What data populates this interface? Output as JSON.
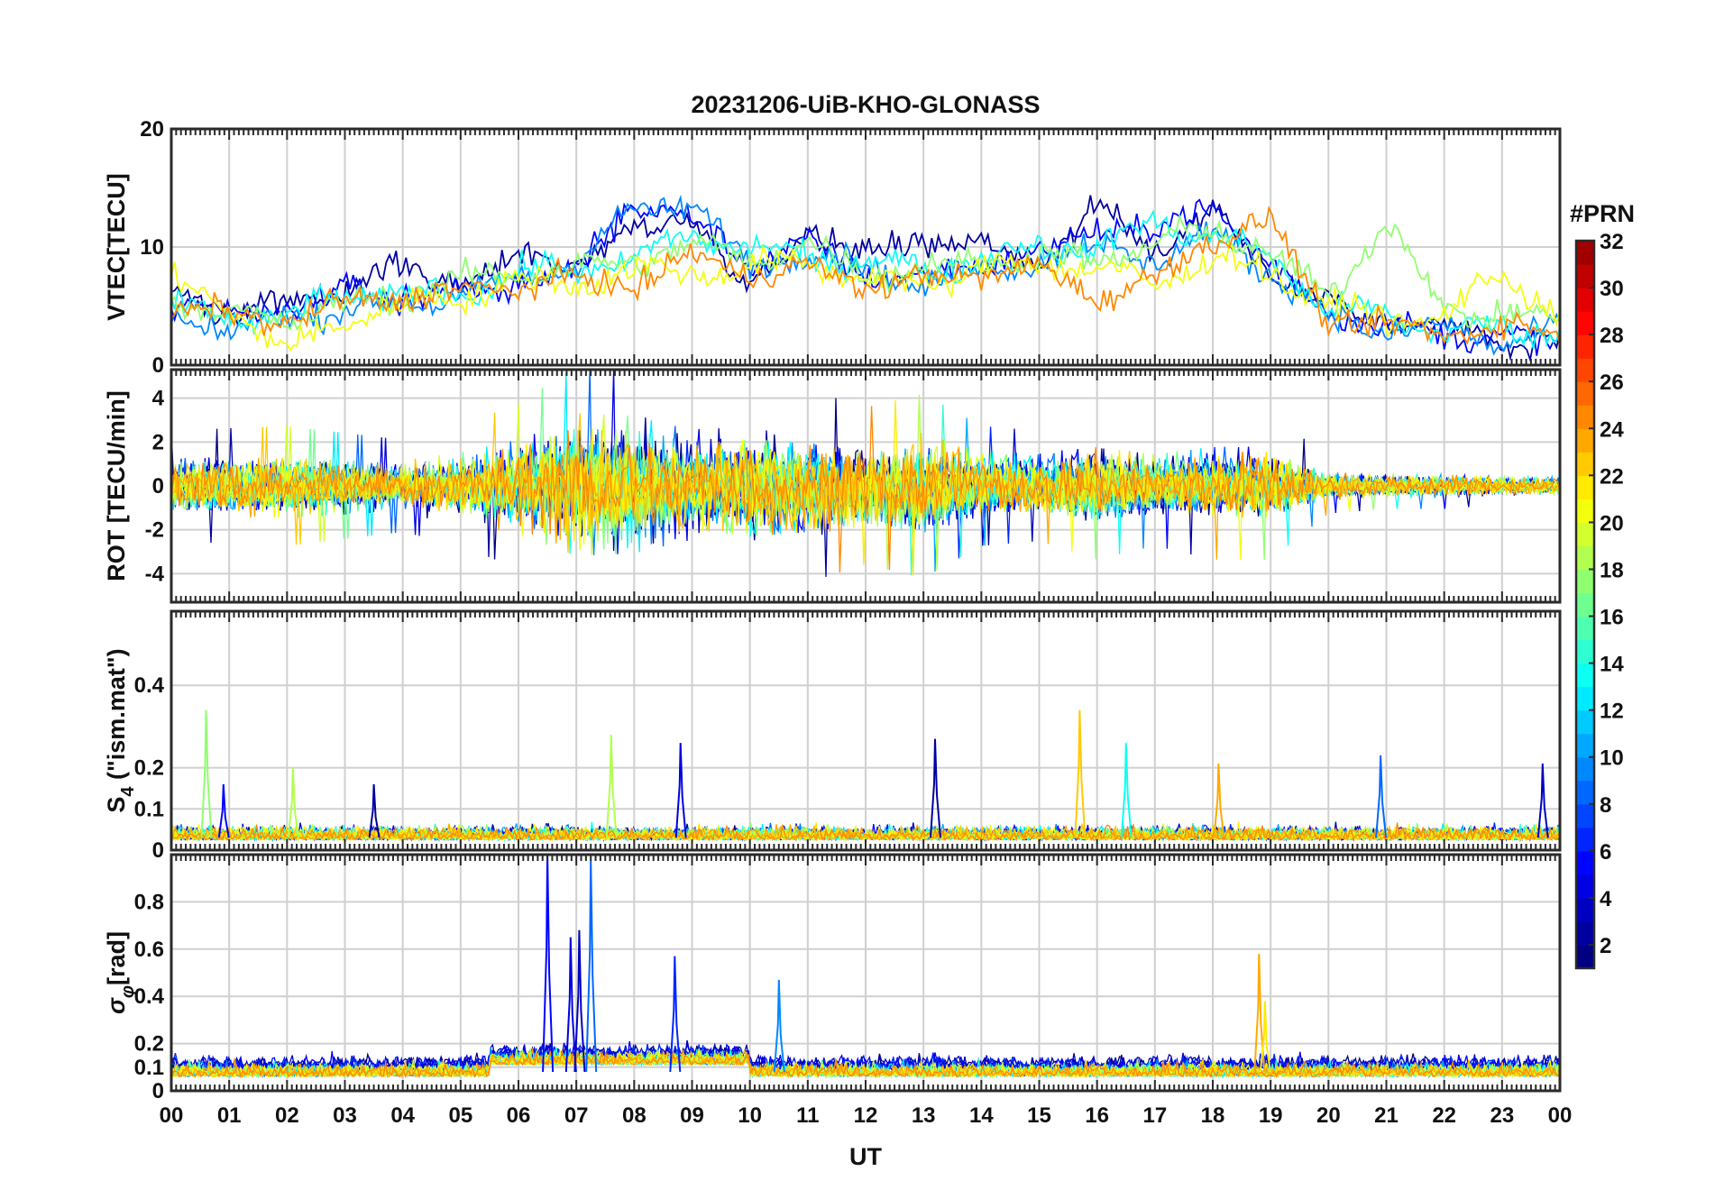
{
  "chart_data": {
    "title": "20231206-UiB-KHO-GLONASS",
    "type": "line",
    "xlabel": "UT",
    "x_ticks": [
      "00",
      "01",
      "02",
      "03",
      "04",
      "05",
      "06",
      "07",
      "08",
      "09",
      "10",
      "11",
      "12",
      "13",
      "14",
      "15",
      "16",
      "17",
      "18",
      "19",
      "20",
      "21",
      "22",
      "23",
      "00"
    ],
    "xlim_hours": [
      0,
      24
    ],
    "grid": true,
    "colorbar": {
      "label": "#PRN",
      "range": [
        1,
        32
      ],
      "ticks": [
        "32",
        "30",
        "28",
        "26",
        "24",
        "22",
        "20",
        "18",
        "16",
        "14",
        "12",
        "10",
        "8",
        "6",
        "4",
        "2"
      ],
      "colormap": "jet",
      "placement": "right"
    },
    "panels": [
      {
        "id": "vtec",
        "ylabel": "VTEC[TECU]",
        "ylim": [
          0,
          20
        ],
        "y_ticks": [
          "20",
          "10",
          "0"
        ],
        "series": [
          {
            "prn": 2,
            "x": [
              0,
              1,
              2,
              3,
              4,
              5,
              6,
              7,
              8,
              9,
              10,
              11,
              12,
              13,
              14,
              15,
              16,
              17,
              18,
              19,
              20,
              21,
              22,
              23,
              24
            ],
            "y": [
              6,
              5,
              5,
              7,
              8,
              7,
              9,
              9,
              11,
              13,
              6,
              12,
              9,
              11,
              10,
              9,
              13,
              10,
              13,
              8,
              5,
              4,
              3,
              2,
              2
            ]
          },
          {
            "prn": 5,
            "x": [
              0,
              1,
              2,
              3,
              4,
              5,
              6,
              7,
              8,
              9,
              10,
              11,
              12,
              13,
              14,
              15,
              16,
              17,
              18,
              19,
              20,
              21,
              22,
              23,
              24
            ],
            "y": [
              5,
              4,
              5,
              6,
              6,
              6,
              7,
              8,
              14,
              12,
              9,
              10,
              8,
              7,
              9,
              9,
              12,
              11,
              14,
              8,
              5,
              3,
              3,
              2,
              2
            ]
          },
          {
            "prn": 9,
            "x": [
              0,
              1,
              2,
              3,
              4,
              5,
              6,
              7,
              8,
              9,
              10,
              11,
              12,
              13,
              14,
              15,
              16,
              17,
              18,
              19,
              20,
              21,
              22,
              23,
              24
            ],
            "y": [
              4,
              3,
              4,
              5,
              5,
              6,
              7,
              9,
              13,
              14,
              8,
              10,
              8,
              7,
              8,
              9,
              10,
              9,
              11,
              8,
              4,
              3,
              3,
              2,
              3
            ]
          },
          {
            "prn": 13,
            "x": [
              0,
              1,
              2,
              3,
              4,
              5,
              6,
              7,
              8,
              9,
              10,
              11,
              12,
              13,
              14,
              15,
              16,
              17,
              18,
              19,
              20,
              21,
              22,
              23,
              24
            ],
            "y": [
              5,
              4,
              4,
              6,
              6,
              6,
              8,
              8,
              9,
              11,
              10,
              9,
              9,
              8,
              9,
              10,
              10,
              12,
              11,
              9,
              5,
              4,
              3,
              3,
              3
            ]
          },
          {
            "prn": 17,
            "x": [
              0,
              1,
              2,
              3,
              4,
              5,
              6,
              7,
              8,
              9,
              10,
              11,
              12,
              13,
              14,
              15,
              16,
              17,
              18,
              19,
              20,
              21,
              22,
              23,
              24
            ],
            "y": [
              6,
              4,
              4,
              5,
              6,
              7,
              8,
              8,
              9,
              10,
              9,
              10,
              8,
              8,
              9,
              9,
              9,
              10,
              12,
              9,
              6,
              12,
              5,
              4,
              4
            ]
          },
          {
            "prn": 20,
            "x": [
              0,
              1,
              2,
              3,
              4,
              5,
              6,
              7,
              8,
              9,
              10,
              11,
              12,
              13,
              14,
              15,
              16,
              17,
              18,
              19,
              20,
              21,
              22,
              23,
              24
            ],
            "y": [
              7,
              5,
              1,
              4,
              5,
              6,
              7,
              7,
              8,
              8,
              8,
              9,
              7,
              7,
              8,
              9,
              8,
              7,
              9,
              8,
              5,
              4,
              4,
              8,
              4
            ]
          },
          {
            "prn": 24,
            "x": [
              0,
              1,
              2,
              3,
              4,
              5,
              6,
              7,
              8,
              9,
              10,
              11,
              12,
              13,
              14,
              15,
              16,
              17,
              18,
              19,
              20,
              21,
              22,
              23,
              24
            ],
            "y": [
              5,
              4,
              4,
              5,
              6,
              6,
              7,
              7,
              7,
              9,
              8,
              8,
              7,
              7,
              8,
              8,
              6,
              7,
              11,
              12,
              4,
              3,
              3,
              3,
              3
            ]
          }
        ]
      },
      {
        "id": "rot",
        "ylabel": "ROT [TECU/min]",
        "ylim": [
          -5.3,
          5.3
        ],
        "y_ticks": [
          "4",
          "2",
          "0",
          "-2",
          "-4"
        ],
        "series_note": "noisy rate-of-TEC traces for every GLONASS PRN",
        "envelope": {
          "x": [
            0,
            2,
            4,
            5,
            6,
            7,
            8,
            9,
            10,
            11,
            12,
            13,
            14,
            15,
            16,
            17,
            18,
            19,
            20,
            21,
            22,
            23,
            24
          ],
          "amp": [
            1.2,
            1.3,
            1.0,
            1.3,
            1.8,
            2.6,
            2.5,
            2.0,
            2.3,
            2.1,
            1.7,
            2.0,
            1.3,
            1.2,
            1.6,
            1.3,
            1.6,
            1.6,
            0.6,
            0.5,
            0.5,
            0.4,
            0.4
          ]
        }
      },
      {
        "id": "s4",
        "ylabel": "S4 (\"ism.mat\")",
        "ylabel_main": "S",
        "ylabel_sub": "4",
        "ylabel_rest": " (\"ism.mat\")",
        "ylim": [
          0,
          0.58
        ],
        "y_ticks": [
          "0.4",
          "0.2",
          "0.1",
          "0"
        ],
        "spikes": [
          {
            "prn": 17,
            "hour": 0.6,
            "value": 0.34
          },
          {
            "prn": 5,
            "hour": 0.9,
            "value": 0.16
          },
          {
            "prn": 18,
            "hour": 2.1,
            "value": 0.2
          },
          {
            "prn": 2,
            "hour": 3.5,
            "value": 0.16
          },
          {
            "prn": 18,
            "hour": 7.6,
            "value": 0.28
          },
          {
            "prn": 4,
            "hour": 8.8,
            "value": 0.26
          },
          {
            "prn": 2,
            "hour": 13.2,
            "value": 0.27
          },
          {
            "prn": 22,
            "hour": 15.7,
            "value": 0.34
          },
          {
            "prn": 13,
            "hour": 16.5,
            "value": 0.26
          },
          {
            "prn": 23,
            "hour": 18.1,
            "value": 0.21
          },
          {
            "prn": 8,
            "hour": 20.9,
            "value": 0.23
          },
          {
            "prn": 3,
            "hour": 23.7,
            "value": 0.21
          }
        ]
      },
      {
        "id": "sigma_phi",
        "ylabel": "σφ[rad]",
        "ylabel_main": "σ",
        "ylabel_sub": "φ",
        "ylabel_rest": "[rad]",
        "ylim": [
          0,
          1.0
        ],
        "y_ticks": [
          "0.8",
          "0.6",
          "0.4",
          "0.2",
          "0.1",
          "0"
        ],
        "spikes": [
          {
            "prn": 5,
            "hour": 6.5,
            "value": 1.0
          },
          {
            "prn": 4,
            "hour": 6.9,
            "value": 0.65
          },
          {
            "prn": 3,
            "hour": 7.05,
            "value": 0.68
          },
          {
            "prn": 8,
            "hour": 7.25,
            "value": 0.98
          },
          {
            "prn": 6,
            "hour": 8.7,
            "value": 0.57
          },
          {
            "prn": 9,
            "hour": 10.5,
            "value": 0.47
          },
          {
            "prn": 23,
            "hour": 18.8,
            "value": 0.58
          },
          {
            "prn": 21,
            "hour": 18.9,
            "value": 0.38
          }
        ]
      }
    ]
  }
}
